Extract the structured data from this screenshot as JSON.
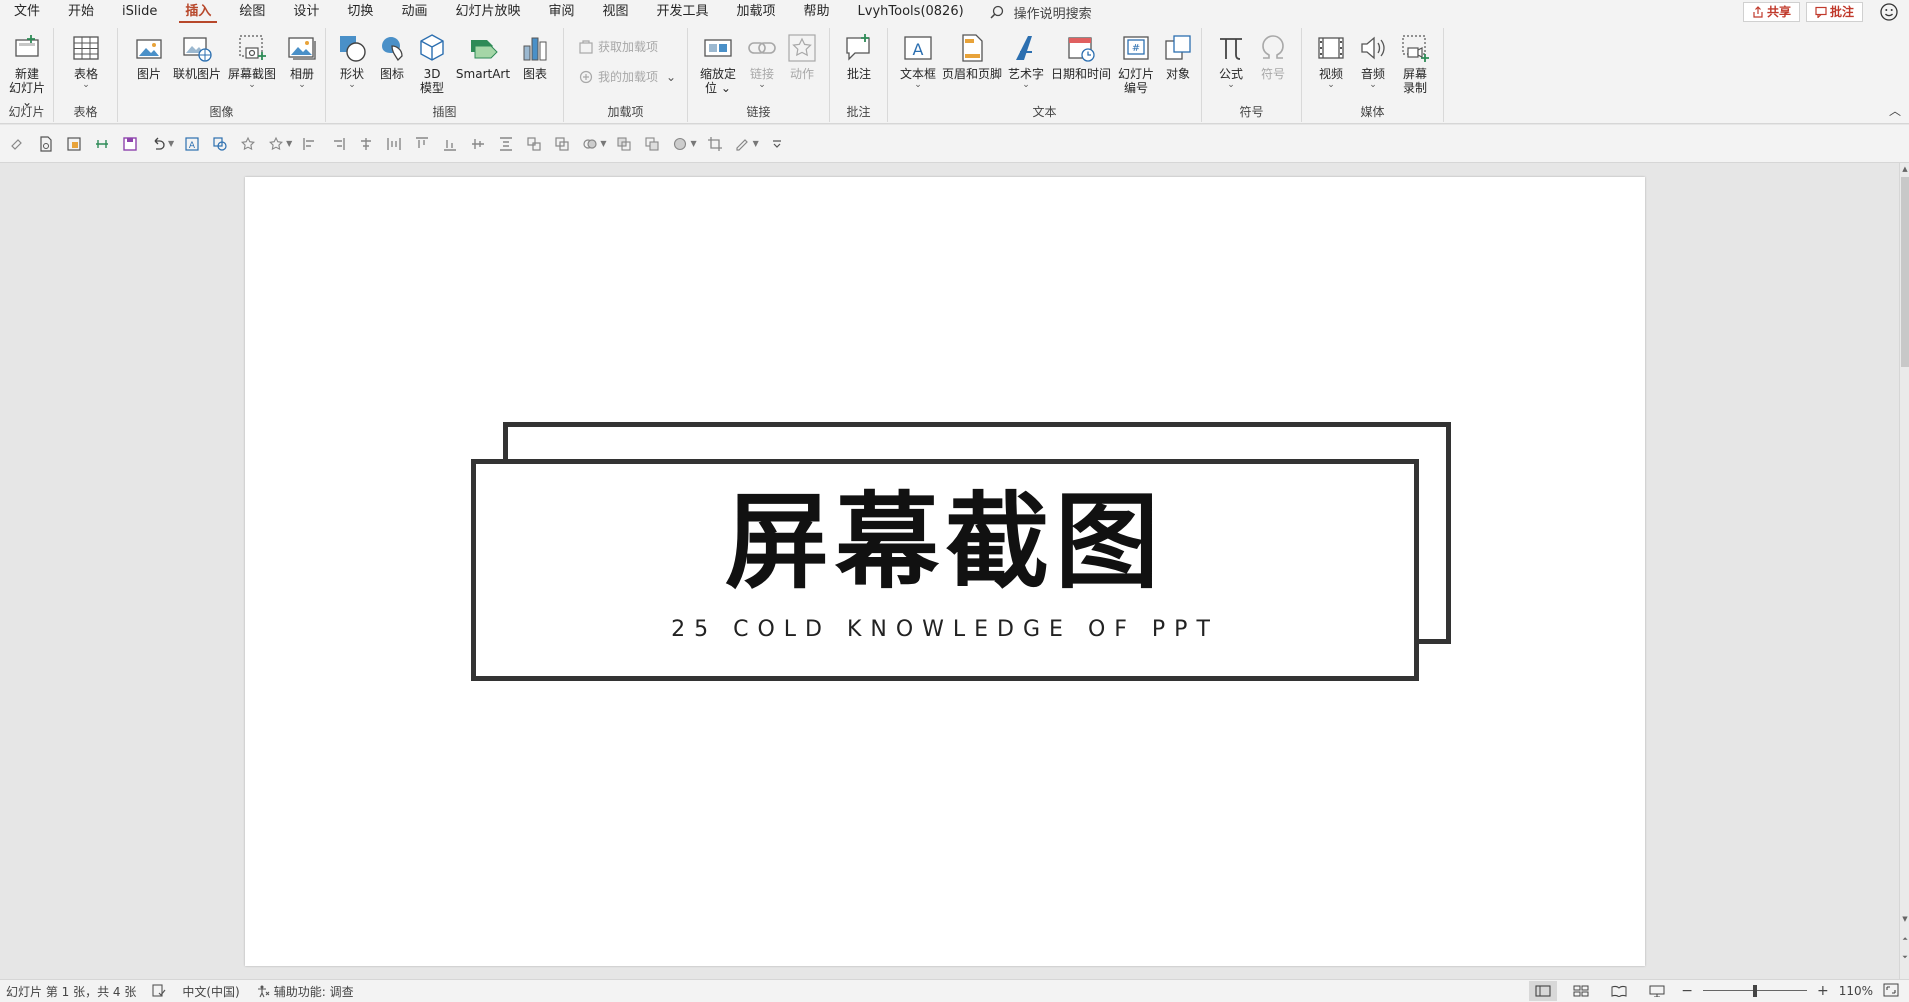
{
  "menu": {
    "tabs": [
      "文件",
      "开始",
      "iSlide",
      "插入",
      "绘图",
      "设计",
      "切换",
      "动画",
      "幻灯片放映",
      "审阅",
      "视图",
      "开发工具",
      "加载项",
      "帮助",
      "LvyhTools(0826)"
    ],
    "active_tab": "插入",
    "search_label": "操作说明搜索",
    "share_label": "共享",
    "comments_label": "批注"
  },
  "ribbon": {
    "groups": {
      "slides": "幻灯片",
      "tables": "表格",
      "images": "图像",
      "illustrations": "插图",
      "addins": "加载项",
      "links": "链接",
      "comments": "批注",
      "text": "文本",
      "symbols": "符号",
      "media": "媒体"
    },
    "buttons": {
      "new_slide_1": "新建",
      "new_slide_2": "幻灯片",
      "table": "表格",
      "picture": "图片",
      "online_picture": "联机图片",
      "screenshot": "屏幕截图",
      "album": "相册",
      "shapes": "形状",
      "icons": "图标",
      "model3d_1": "3D",
      "model3d_2": "模型",
      "smartart": "SmartArt",
      "chart": "图表",
      "get_addins": "获取加载项",
      "my_addins": "我的加载项",
      "zoom_1": "缩放定",
      "zoom_2": "位",
      "link": "链接",
      "action": "动作",
      "comment": "批注",
      "textbox": "文本框",
      "header_footer": "页眉和页脚",
      "wordart": "艺术字",
      "datetime": "日期和时间",
      "slide_number_1": "幻灯片",
      "slide_number_2": "编号",
      "object": "对象",
      "equation": "公式",
      "symbol": "符号",
      "video": "视频",
      "audio": "音频",
      "screen_rec_1": "屏幕",
      "screen_rec_2": "录制"
    }
  },
  "slide": {
    "title": "屏幕截图",
    "subtitle": "25 COLD KNOWLEDGE OF PPT"
  },
  "status": {
    "slide_info": "幻灯片 第 1 张，共 4 张",
    "language": "中文(中国)",
    "accessibility": "辅助功能: 调查",
    "zoom": "110%",
    "zoom_minus": "−",
    "zoom_plus": "+",
    "zoom_level": 0.5
  },
  "colors": {
    "accent": "#b7472a",
    "frame": "#333333"
  }
}
